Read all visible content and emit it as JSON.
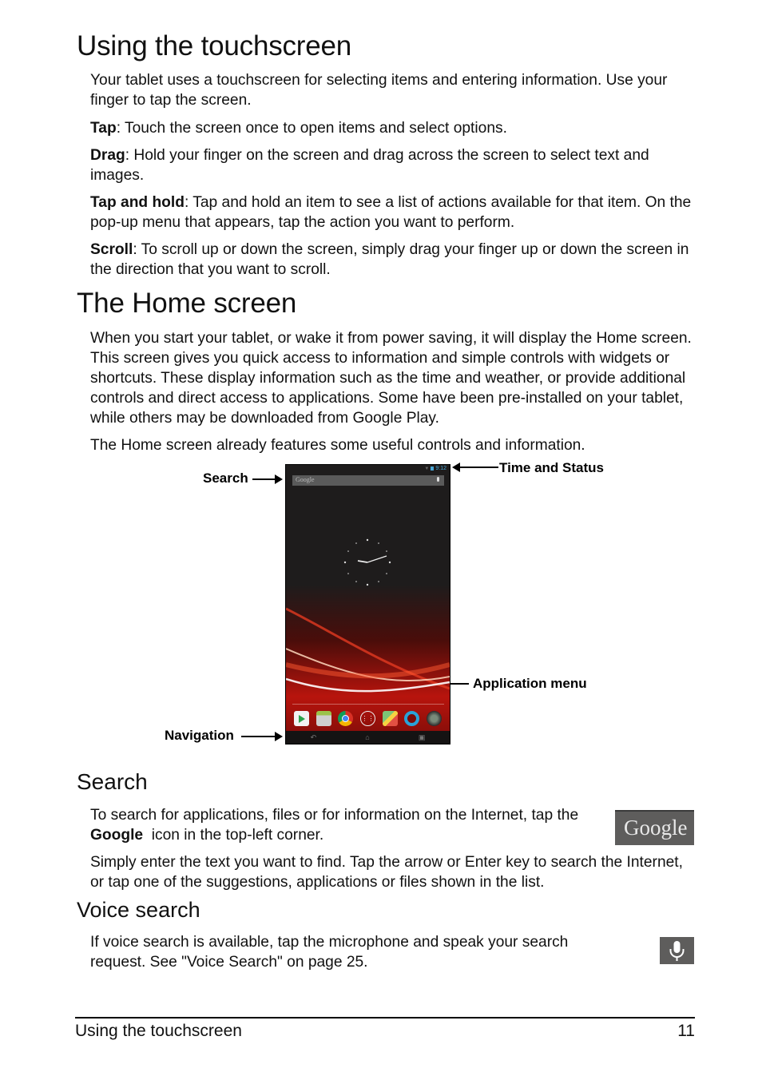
{
  "sections": {
    "touchscreen": {
      "title": "Using the touchscreen",
      "intro": "Your tablet uses a touchscreen for selecting items and entering information. Use your finger to tap the screen.",
      "gestures": [
        {
          "term": "Tap",
          "desc": ": Touch the screen once to open items and select options."
        },
        {
          "term": "Drag",
          "desc": ": Hold your finger on the screen and drag across the screen to select text and images."
        },
        {
          "term": "Tap and hold",
          "desc": ": Tap and hold an item to see a list of actions available for that item. On the pop-up menu that appears, tap the action you want to perform."
        },
        {
          "term": "Scroll",
          "desc": ": To scroll up or down the screen, simply drag your finger up or down the screen in the direction that you want to scroll."
        }
      ]
    },
    "home": {
      "title": "The Home screen",
      "intro": "When you start your tablet, or wake it from power saving, it will display the Home screen. This screen gives you quick access to information and simple controls with widgets or shortcuts. These display information such as the time and weather, or provide additional controls and direct access to applications. Some have been pre-installed on your tablet, while others may be downloaded from Google Play.",
      "features": "The Home screen already features some useful controls and information."
    },
    "search": {
      "title": "Search",
      "p1_before": "To search for applications, files or for information on the Internet, tap the ",
      "p1_bold": "Google",
      "p1_after": "  icon in the top-left corner.",
      "p2": "Simply enter the text you want to find. Tap the arrow or Enter key to search the Internet, or tap one of the suggestions, applications or files shown in the list.",
      "icon_label": "Google"
    },
    "voice": {
      "title": "Voice search",
      "p1": "If voice search is available, tap the microphone and speak your search request. See \"Voice Search\" on page 25."
    }
  },
  "figure": {
    "callouts": {
      "search": "Search",
      "time_status": "Time and Status",
      "app_menu": "Application menu",
      "navigation": "Navigation"
    },
    "screen": {
      "status_time": "9:12",
      "search_placeholder": "Google",
      "dock_apps": [
        "play-store",
        "gallery",
        "chrome",
        "app-menu",
        "maps",
        "camera",
        "game"
      ],
      "nav_buttons": [
        "back",
        "home",
        "recents"
      ]
    }
  },
  "footer": {
    "section": "Using the touchscreen",
    "page": "11"
  }
}
